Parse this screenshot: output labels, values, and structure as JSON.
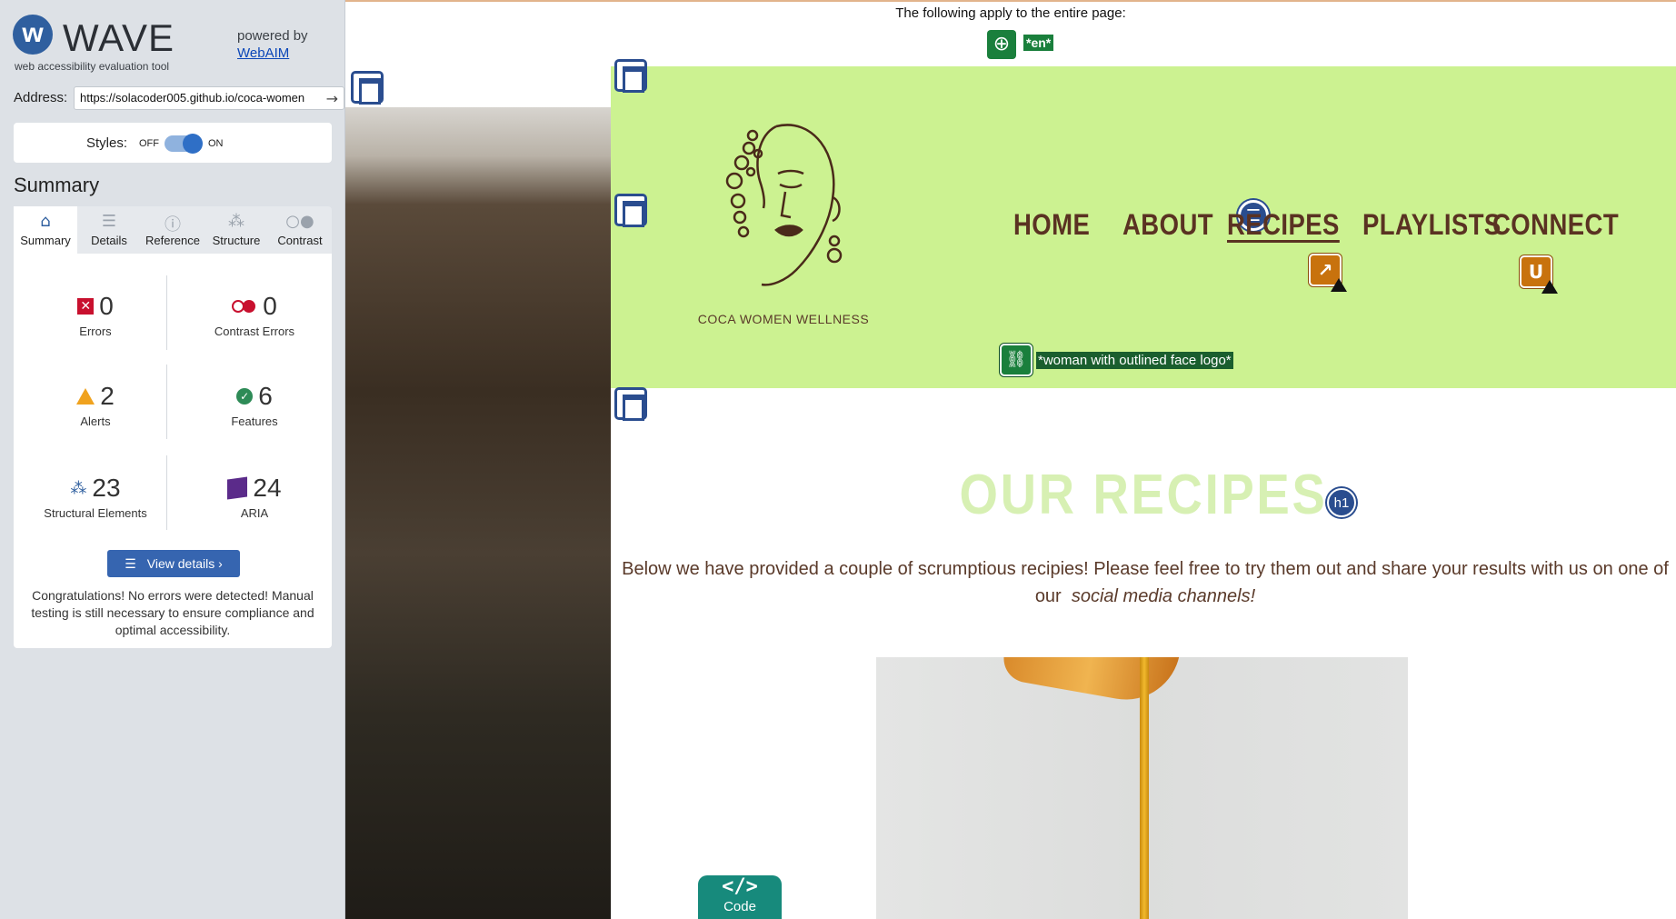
{
  "wave": {
    "logo_letter": "w",
    "logo_word": "WAVE",
    "tagline": "web accessibility evaluation tool",
    "powered_by": "powered by",
    "powered_link": "WebAIM",
    "address_label": "Address:",
    "address_value": "https://solacoder005.github.io/coca-women",
    "styles_label": "Styles:",
    "styles_off": "OFF",
    "styles_on": "ON",
    "summary_title": "Summary",
    "tabs": [
      {
        "label": "Summary",
        "icon": "home-icon",
        "active": true
      },
      {
        "label": "Details",
        "icon": "list-icon",
        "active": false
      },
      {
        "label": "Reference",
        "icon": "info-icon",
        "active": false
      },
      {
        "label": "Structure",
        "icon": "hierarchy-icon",
        "active": false
      },
      {
        "label": "Contrast",
        "icon": "contrast-icon",
        "active": false
      }
    ],
    "stats": {
      "errors": {
        "count": "0",
        "label": "Errors"
      },
      "contrast_errors": {
        "count": "0",
        "label": "Contrast Errors"
      },
      "alerts": {
        "count": "2",
        "label": "Alerts"
      },
      "features": {
        "count": "6",
        "label": "Features"
      },
      "structural": {
        "count": "23",
        "label": "Structural Elements"
      },
      "aria": {
        "count": "24",
        "label": "ARIA"
      }
    },
    "view_details": "View details ›",
    "congrats": "Congratulations! No errors were detected! Manual testing is still necessary to ensure compliance and optimal accessibility."
  },
  "page": {
    "top_note": "The following apply to the entire page:",
    "lang_label": "*en*",
    "logo_caption": "COCA WOMEN WELLNESS",
    "logo_alt_label": "*woman with outlined face logo*",
    "nav": [
      "HOME",
      "ABOUT",
      "RECIPES",
      "PLAYLISTS",
      "CONNECT"
    ],
    "current_nav": "RECIPES",
    "h1_badge": "h1",
    "heading": "OUR RECIPES",
    "intro_text": "Below we have provided a couple of scrumptious recipies! Please feel free to try them out and share your results with us on one of our",
    "intro_link": "social media channels!",
    "alert_link_badge": "↗",
    "alert_underline_badge": "U",
    "code_symbol": "</>",
    "code_label": "Code"
  },
  "colors": {
    "header_band": "#ccf291",
    "heading": "#d7f0b3",
    "brown_text": "#5a3222",
    "wave_blue": "#2a4d8f",
    "feature_green": "#1a7f3c",
    "alert_orange": "#c8720d",
    "code_teal": "#178a7c"
  }
}
